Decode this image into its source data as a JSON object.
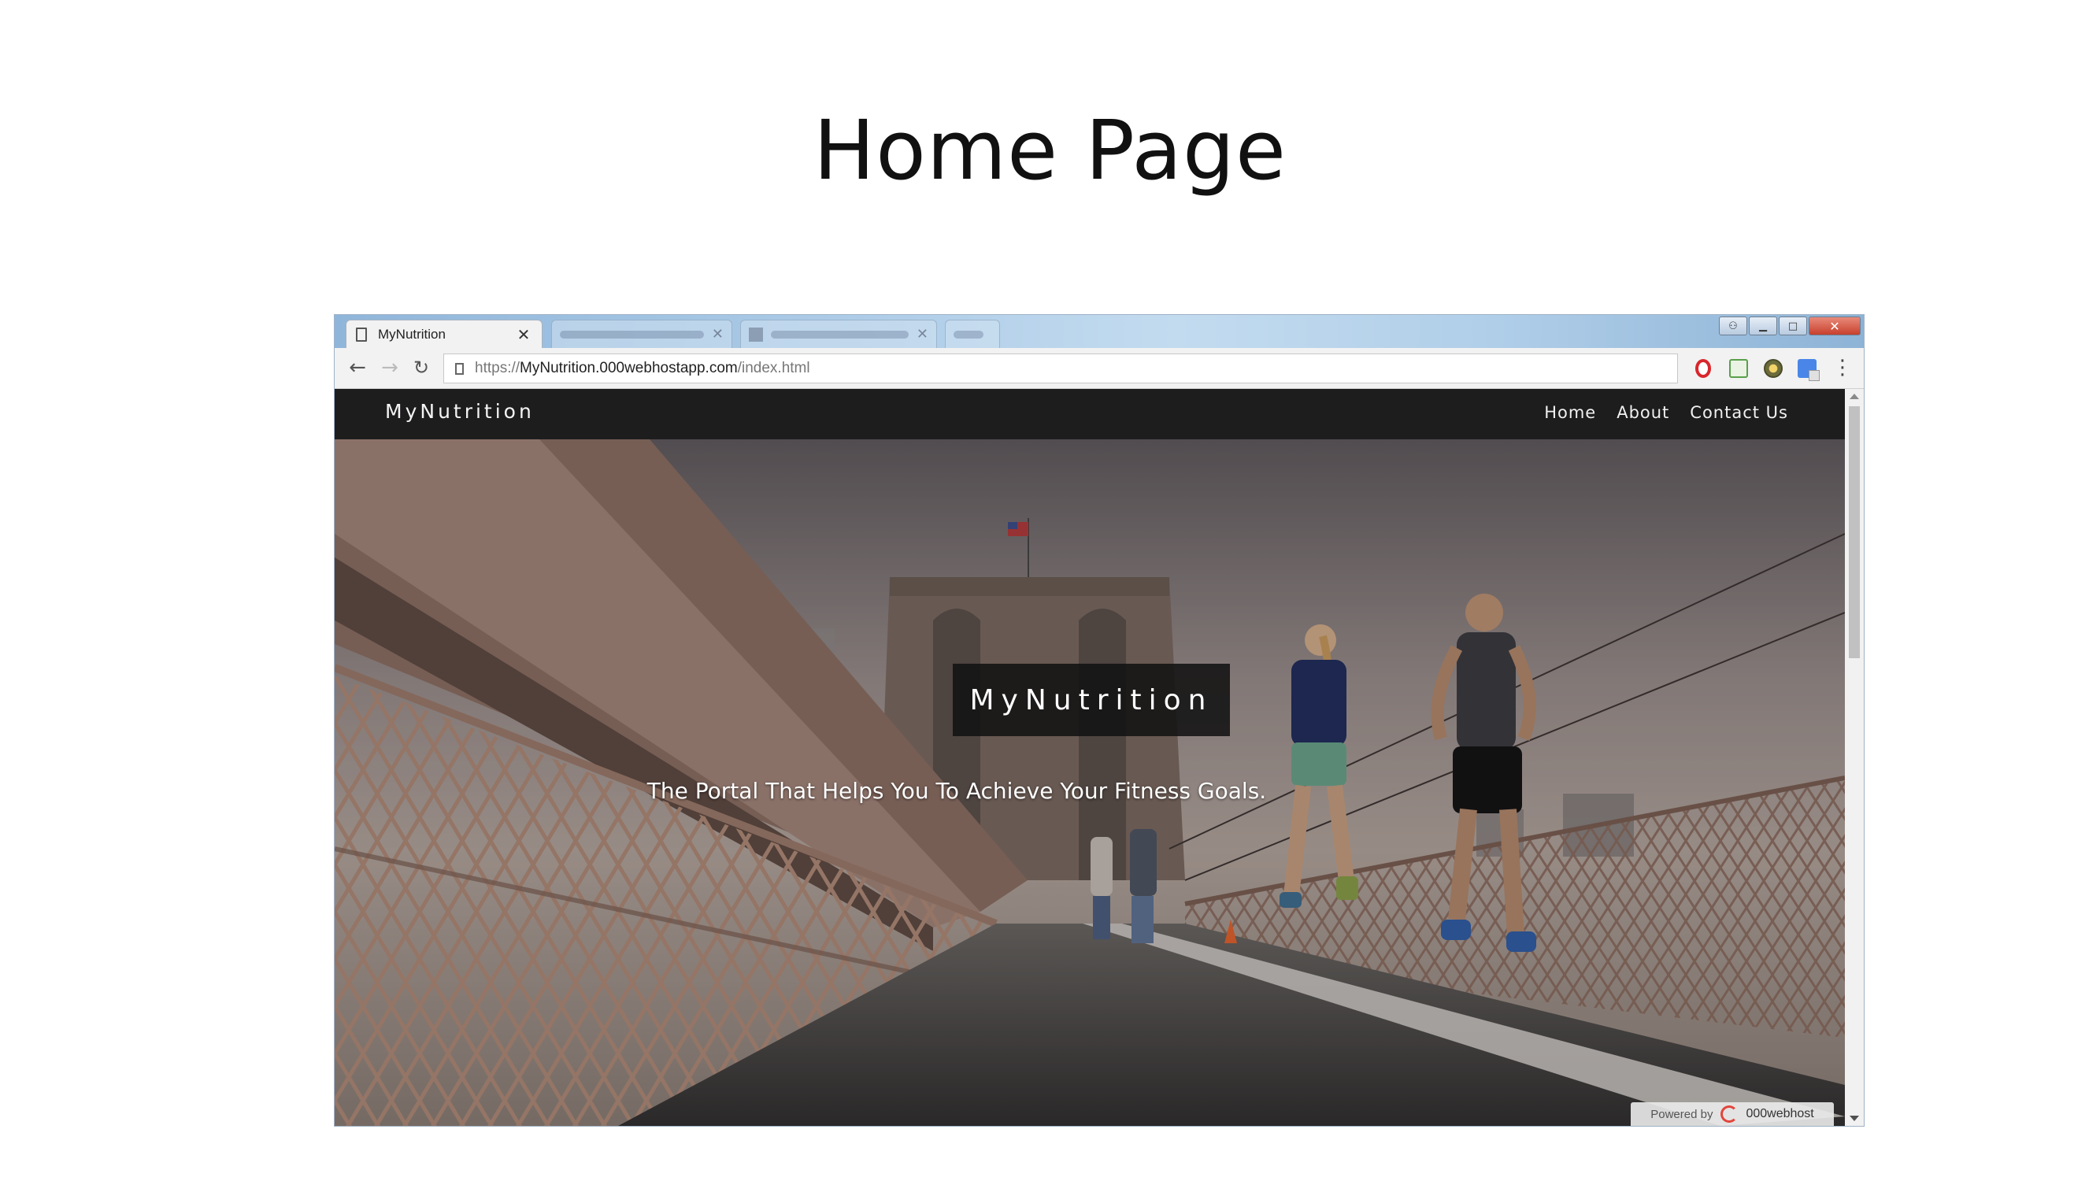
{
  "slide": {
    "title": "Home Page"
  },
  "browser": {
    "tabs": [
      {
        "label": "MyNutrition",
        "active": true
      }
    ],
    "url": {
      "scheme": "https://",
      "host": "MyNutrition.000webhostapp.com",
      "path": "/index.html"
    },
    "icons": {
      "back": "back-arrow-icon",
      "forward": "forward-arrow-icon",
      "reload": "reload-icon",
      "menu": "menu-icon"
    }
  },
  "site": {
    "brand": "MyNutrition",
    "nav": [
      "Home",
      "About",
      "Contact Us"
    ],
    "hero": {
      "title": "MyNutrition",
      "tagline": "The Portal That Helps You To Achieve Your Fitness Goals."
    },
    "badge": {
      "prefix": "Powered by",
      "brand": "000webhost"
    }
  }
}
